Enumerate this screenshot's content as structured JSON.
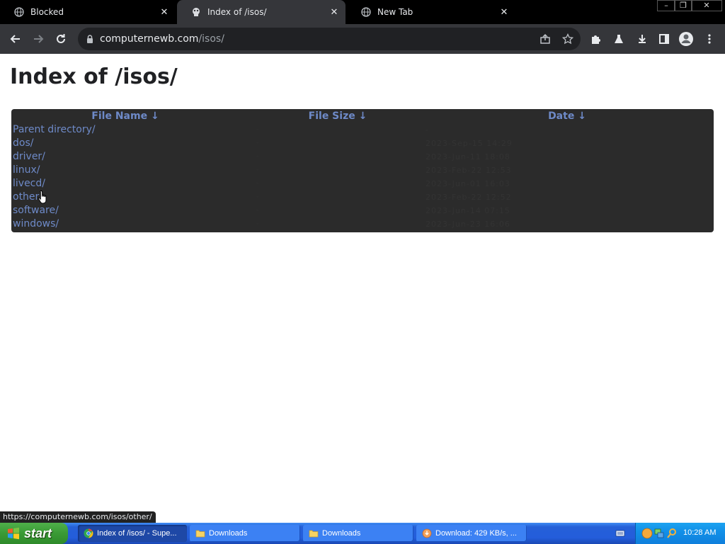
{
  "browser": {
    "tabs": [
      {
        "title": "Blocked",
        "icon": "globe-icon",
        "active": false
      },
      {
        "title": "Index of /isos/",
        "icon": "site-logo-icon",
        "active": true
      },
      {
        "title": "New Tab",
        "icon": "globe-icon",
        "active": false
      }
    ],
    "window_controls": {
      "minimize": "–",
      "restore": "❐",
      "close": "✕"
    },
    "address": {
      "host": "computernewb.com",
      "path": "/isos/"
    },
    "status_url": "https://computernewb.com/isos/other/"
  },
  "page": {
    "title": "Index of /isos/",
    "columns": [
      {
        "label": "File Name",
        "sort_glyph": "↓"
      },
      {
        "label": "File Size",
        "sort_glyph": "↓"
      },
      {
        "label": "Date",
        "sort_glyph": "↓"
      }
    ],
    "rows": [
      {
        "name": "Parent directory/",
        "size": "-",
        "date": "-"
      },
      {
        "name": "dos/",
        "size": "-",
        "date": "2023-Sep-15 14:29"
      },
      {
        "name": "driver/",
        "size": "-",
        "date": "2023-Jun-11 18:08"
      },
      {
        "name": "linux/",
        "size": "-",
        "date": "2023-Feb-22 12:53"
      },
      {
        "name": "livecd/",
        "size": "-",
        "date": "2023-Jun-01 16:03"
      },
      {
        "name": "other/",
        "size": "-",
        "date": "2023-Feb-22 12:52"
      },
      {
        "name": "software/",
        "size": "-",
        "date": "2023-Jun-14 07:15"
      },
      {
        "name": "windows/",
        "size": "-",
        "date": "2023-Jun-23 16:06"
      }
    ]
  },
  "taskbar": {
    "start_label": "start",
    "tasks": [
      {
        "label": "Index of /isos/ - Supe...",
        "icon": "chrome-icon",
        "active": true
      },
      {
        "label": "Downloads",
        "icon": "folder-icon",
        "active": false
      },
      {
        "label": "Downloads",
        "icon": "folder-icon",
        "active": false
      },
      {
        "label": "Download: 429 KB/s, ...",
        "icon": "download-icon",
        "active": false
      }
    ],
    "clock": "10:28 AM"
  },
  "colors": {
    "link": "#6e8ac8",
    "table_bg": "#2b2b2b",
    "browser_frame": "#35363a",
    "taskbar_blue": "#245ddb"
  }
}
